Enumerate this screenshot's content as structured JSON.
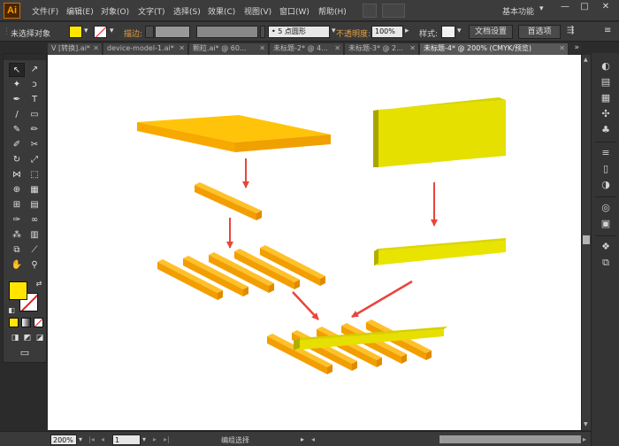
{
  "app": {
    "logo": "Ai",
    "workspace": "基本功能"
  },
  "menu": [
    "文件(F)",
    "编辑(E)",
    "对象(O)",
    "文字(T)",
    "选择(S)",
    "效果(C)",
    "视图(V)",
    "窗口(W)",
    "帮助(H)"
  ],
  "window_controls": {
    "minimize": "—",
    "maximize": "□",
    "close": "✕"
  },
  "control_bar": {
    "selection_label": "未选择对象",
    "stroke_label": "描边:",
    "stroke_style": "5 点圆形",
    "opacity_label": "不透明度:",
    "opacity_value": "100%",
    "style_label": "样式:",
    "doc_setup": "文档设置",
    "preferences": "首选项"
  },
  "tabs": [
    {
      "label": "V [转换].ai*",
      "active": false
    },
    {
      "label": "device-model-1.ai*",
      "active": false
    },
    {
      "label": "颗粒.ai* @ 60...",
      "active": false
    },
    {
      "label": "未标题-2* @ 4...",
      "active": false
    },
    {
      "label": "未标题-3* @ 2...",
      "active": false
    },
    {
      "label": "未标题-4* @ 200% (CMYK/预览)",
      "active": true
    }
  ],
  "tab_overflow": "»",
  "tools": [
    {
      "name": "selection-tool",
      "glyph": "↖",
      "selected": true
    },
    {
      "name": "direct-selection-tool",
      "glyph": "↗"
    },
    {
      "name": "magic-wand-tool",
      "glyph": "✦"
    },
    {
      "name": "lasso-tool",
      "glyph": "ↄ"
    },
    {
      "name": "pen-tool",
      "glyph": "✒"
    },
    {
      "name": "type-tool",
      "glyph": "T"
    },
    {
      "name": "line-tool",
      "glyph": "/"
    },
    {
      "name": "rectangle-tool",
      "glyph": "▭"
    },
    {
      "name": "paintbrush-tool",
      "glyph": "✎"
    },
    {
      "name": "pencil-tool",
      "glyph": "✏"
    },
    {
      "name": "blob-brush-tool",
      "glyph": "✐"
    },
    {
      "name": "scissors-tool",
      "glyph": "✂"
    },
    {
      "name": "rotate-tool",
      "glyph": "↻"
    },
    {
      "name": "scale-tool",
      "glyph": "⤢"
    },
    {
      "name": "width-tool",
      "glyph": "⋈"
    },
    {
      "name": "free-transform-tool",
      "glyph": "⬚"
    },
    {
      "name": "shape-builder-tool",
      "glyph": "⊕"
    },
    {
      "name": "perspective-grid-tool",
      "glyph": "▦"
    },
    {
      "name": "mesh-tool",
      "glyph": "⊞"
    },
    {
      "name": "gradient-tool",
      "glyph": "▤"
    },
    {
      "name": "eyedropper-tool",
      "glyph": "✑"
    },
    {
      "name": "blend-tool",
      "glyph": "∞"
    },
    {
      "name": "symbol-sprayer-tool",
      "glyph": "⁂"
    },
    {
      "name": "column-graph-tool",
      "glyph": "▥"
    },
    {
      "name": "artboard-tool",
      "glyph": "⧉"
    },
    {
      "name": "slice-tool",
      "glyph": "⟋"
    },
    {
      "name": "hand-tool",
      "glyph": "✋"
    },
    {
      "name": "zoom-tool",
      "glyph": "⚲"
    }
  ],
  "colors": {
    "fill": "#ffe500",
    "stroke": "none",
    "accent": "#ff9a00"
  },
  "right_panel": [
    "color-panel-icon",
    "color-guide-icon",
    "swatches-icon",
    "brushes-icon",
    "symbols-icon",
    "stroke-icon",
    "gradient-icon",
    "transparency-icon",
    "appearance-icon",
    "graphic-styles-icon",
    "layers-icon",
    "artboards-icon"
  ],
  "status": {
    "zoom": "200%",
    "artboard": "1",
    "mode": "编组选择"
  }
}
